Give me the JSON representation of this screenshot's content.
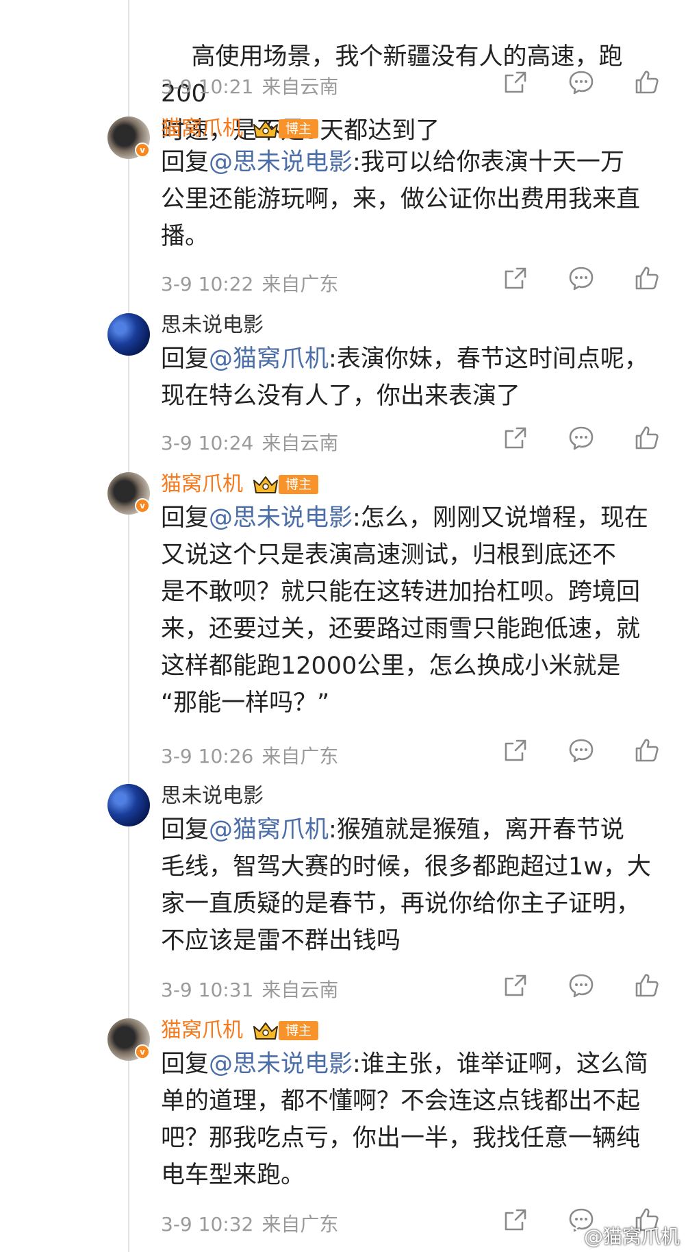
{
  "comments": [
    {
      "content": "高使用场景，我个新疆没有人的高速，跑200\n时速，是不是5天都达到了",
      "time": "3-9 10:21",
      "location": "来自云南"
    },
    {
      "user": "猫窝爪机",
      "badge": "博主",
      "prefix": "回复",
      "mention": "@思未说电影",
      "content": ":我可以给你表演十天一万\n公里还能游玩啊，来，做公证你出费用我来直\n播。",
      "time": "3-9 10:22",
      "location": "来自广东"
    },
    {
      "user": "思未说电影",
      "prefix": "回复",
      "mention": "@猫窝爪机",
      "content": ":表演你妹，春节这时间点呢，\n现在特么没有人了，你出来表演了",
      "time": "3-9 10:24",
      "location": "来自云南"
    },
    {
      "user": "猫窝爪机",
      "badge": "博主",
      "prefix": "回复",
      "mention": "@思未说电影",
      "content": ":怎么，刚刚又说增程，现在\n又说这个只是表演高速测试，归根到底还不\n是不敢呗？就只能在这转进加抬杠呗。跨境回\n来，还要过关，还要路过雨雪只能跑低速，就\n这样都能跑12000公里，怎么换成小米就是\n“那能一样吗？”",
      "time": "3-9 10:26",
      "location": "来自广东"
    },
    {
      "user": "思未说电影",
      "prefix": "回复",
      "mention": "@猫窝爪机",
      "content": ":猴殖就是猴殖，离开春节说\n毛线，智驾大赛的时候，很多都跑超过1w，大\n家一直质疑的是春节，再说你给你主子证明，\n不应该是雷不群出钱吗",
      "time": "3-9 10:31",
      "location": "来自云南"
    },
    {
      "user": "猫窝爪机",
      "badge": "博主",
      "prefix": "回复",
      "mention": "@思未说电影",
      "content": ":谁主张，谁举证啊，这么简\n单的道理，都不懂啊？不会连这点钱都出不起\n吧？那我吃点亏，你出一半，我找任意一辆纯\n电车型来跑。",
      "time": "3-9 10:32",
      "location": "来自广东"
    }
  ],
  "watermark": "@猫窝爪机",
  "icons": {
    "share": "share-icon",
    "comment": "comment-icon",
    "like": "like-icon",
    "crown": "crown-icon",
    "watermark_logo": "weibo-logo-icon"
  },
  "colors": {
    "vip_name": "#f57a1d",
    "mention": "#4c6ea8",
    "badge_bg": "#f7932a",
    "meta": "#9a9a9a"
  }
}
